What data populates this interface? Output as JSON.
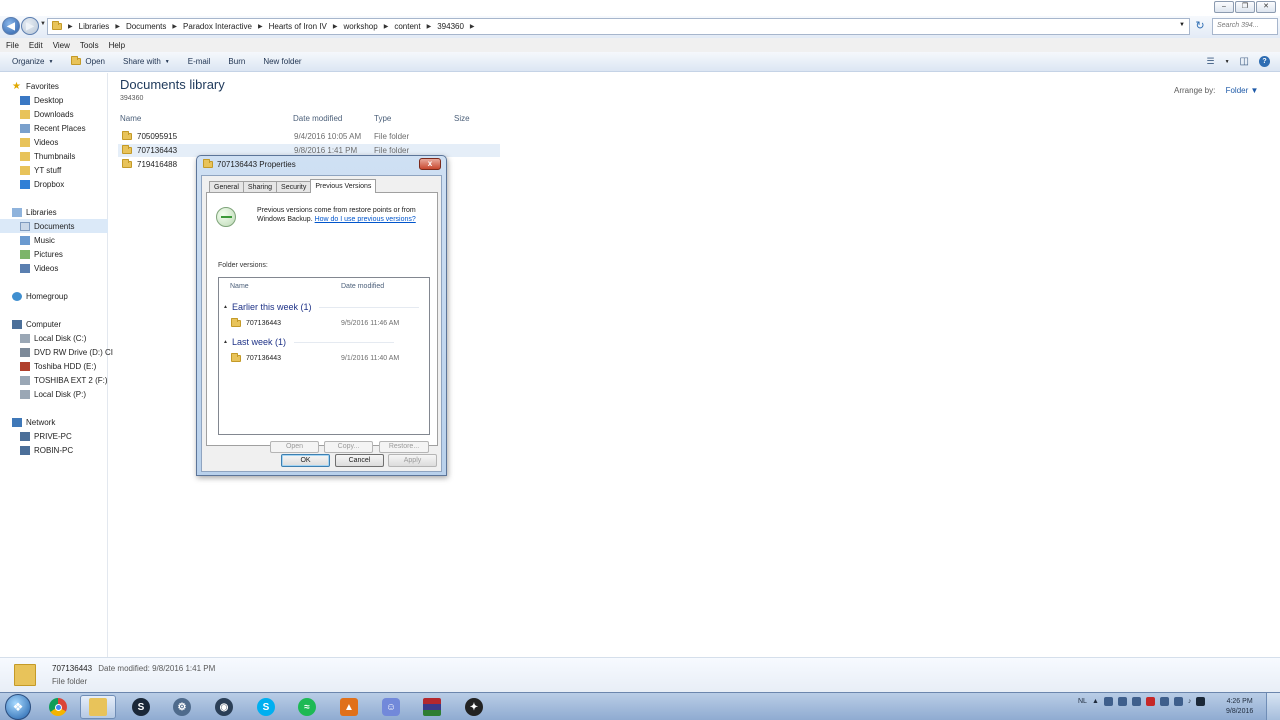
{
  "breadcrumbs": [
    "Libraries",
    "Documents",
    "Paradox Interactive",
    "Hearts of Iron IV",
    "workshop",
    "content",
    "394360"
  ],
  "search": {
    "placeholder": "Search 394..."
  },
  "menu": [
    "File",
    "Edit",
    "View",
    "Tools",
    "Help"
  ],
  "commands": {
    "organize": "Organize",
    "open": "Open",
    "share_with": "Share with",
    "email": "E-mail",
    "burn": "Burn",
    "new_folder": "New folder"
  },
  "nav": {
    "favorites": "Favorites",
    "fav_items": [
      "Desktop",
      "Downloads",
      "Recent Places",
      "Videos",
      "Thumbnails",
      "YT stuff",
      "Dropbox"
    ],
    "libraries": "Libraries",
    "lib_items": [
      "Documents",
      "Music",
      "Pictures",
      "Videos"
    ],
    "homegroup": "Homegroup",
    "computer": "Computer",
    "comp_items": [
      "Local Disk (C:)",
      "DVD RW Drive (D:) CI",
      "Toshiba HDD (E:)",
      "TOSHIBA EXT 2 (F:)",
      "Local Disk (P:)"
    ],
    "network": "Network",
    "net_items": [
      "PRIVE-PC",
      "ROBIN-PC"
    ]
  },
  "library": {
    "title": "Documents library",
    "subtitle": "394360",
    "arrange_label": "Arrange by:",
    "arrange_value": "Folder"
  },
  "columns": {
    "name": "Name",
    "date": "Date modified",
    "type": "Type",
    "size": "Size"
  },
  "files": [
    {
      "name": "705095915",
      "date": "9/4/2016 10:05 AM",
      "type": "File folder"
    },
    {
      "name": "707136443",
      "date": "9/8/2016 1:41 PM",
      "type": "File folder"
    },
    {
      "name": "719416488",
      "date": "",
      "type": ""
    }
  ],
  "dialog": {
    "title": "707136443 Properties",
    "close": "x",
    "tabs": [
      "General",
      "Sharing",
      "Security",
      "Previous Versions"
    ],
    "info_text": "Previous versions come from restore points or from Windows Backup.",
    "info_link": "How do I use previous versions?",
    "folder_versions_label": "Folder versions:",
    "list_headers": {
      "name": "Name",
      "date": "Date modified"
    },
    "groups": [
      {
        "label": "Earlier this week (1)",
        "item": {
          "name": "707136443",
          "date": "9/5/2016 11:46 AM"
        }
      },
      {
        "label": "Last week (1)",
        "item": {
          "name": "707136443",
          "date": "9/1/2016 11:40 AM"
        }
      }
    ],
    "panel_buttons": {
      "open": "Open",
      "copy": "Copy...",
      "restore": "Restore..."
    },
    "buttons": {
      "ok": "OK",
      "cancel": "Cancel",
      "apply": "Apply"
    }
  },
  "details": {
    "name": "707136443",
    "date_label": "Date modified: 9/8/2016 1:41 PM",
    "type": "File folder"
  },
  "tray": {
    "lang": "NL",
    "time": "4:26 PM",
    "date": "9/8/2016"
  }
}
